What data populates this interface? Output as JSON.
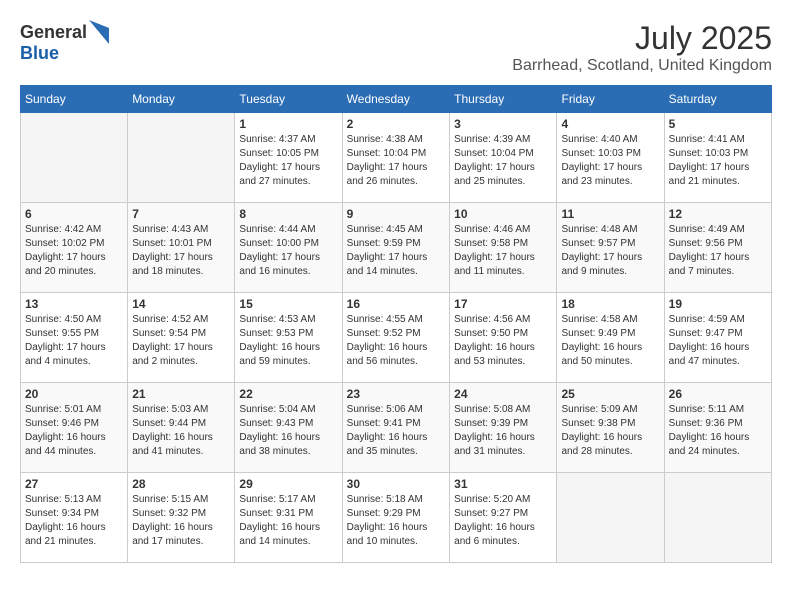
{
  "header": {
    "logo_general": "General",
    "logo_blue": "Blue",
    "month_title": "July 2025",
    "location": "Barrhead, Scotland, United Kingdom"
  },
  "weekdays": [
    "Sunday",
    "Monday",
    "Tuesday",
    "Wednesday",
    "Thursday",
    "Friday",
    "Saturday"
  ],
  "weeks": [
    [
      {
        "day": "",
        "info": ""
      },
      {
        "day": "",
        "info": ""
      },
      {
        "day": "1",
        "info": "Sunrise: 4:37 AM\nSunset: 10:05 PM\nDaylight: 17 hours and 27 minutes."
      },
      {
        "day": "2",
        "info": "Sunrise: 4:38 AM\nSunset: 10:04 PM\nDaylight: 17 hours and 26 minutes."
      },
      {
        "day": "3",
        "info": "Sunrise: 4:39 AM\nSunset: 10:04 PM\nDaylight: 17 hours and 25 minutes."
      },
      {
        "day": "4",
        "info": "Sunrise: 4:40 AM\nSunset: 10:03 PM\nDaylight: 17 hours and 23 minutes."
      },
      {
        "day": "5",
        "info": "Sunrise: 4:41 AM\nSunset: 10:03 PM\nDaylight: 17 hours and 21 minutes."
      }
    ],
    [
      {
        "day": "6",
        "info": "Sunrise: 4:42 AM\nSunset: 10:02 PM\nDaylight: 17 hours and 20 minutes."
      },
      {
        "day": "7",
        "info": "Sunrise: 4:43 AM\nSunset: 10:01 PM\nDaylight: 17 hours and 18 minutes."
      },
      {
        "day": "8",
        "info": "Sunrise: 4:44 AM\nSunset: 10:00 PM\nDaylight: 17 hours and 16 minutes."
      },
      {
        "day": "9",
        "info": "Sunrise: 4:45 AM\nSunset: 9:59 PM\nDaylight: 17 hours and 14 minutes."
      },
      {
        "day": "10",
        "info": "Sunrise: 4:46 AM\nSunset: 9:58 PM\nDaylight: 17 hours and 11 minutes."
      },
      {
        "day": "11",
        "info": "Sunrise: 4:48 AM\nSunset: 9:57 PM\nDaylight: 17 hours and 9 minutes."
      },
      {
        "day": "12",
        "info": "Sunrise: 4:49 AM\nSunset: 9:56 PM\nDaylight: 17 hours and 7 minutes."
      }
    ],
    [
      {
        "day": "13",
        "info": "Sunrise: 4:50 AM\nSunset: 9:55 PM\nDaylight: 17 hours and 4 minutes."
      },
      {
        "day": "14",
        "info": "Sunrise: 4:52 AM\nSunset: 9:54 PM\nDaylight: 17 hours and 2 minutes."
      },
      {
        "day": "15",
        "info": "Sunrise: 4:53 AM\nSunset: 9:53 PM\nDaylight: 16 hours and 59 minutes."
      },
      {
        "day": "16",
        "info": "Sunrise: 4:55 AM\nSunset: 9:52 PM\nDaylight: 16 hours and 56 minutes."
      },
      {
        "day": "17",
        "info": "Sunrise: 4:56 AM\nSunset: 9:50 PM\nDaylight: 16 hours and 53 minutes."
      },
      {
        "day": "18",
        "info": "Sunrise: 4:58 AM\nSunset: 9:49 PM\nDaylight: 16 hours and 50 minutes."
      },
      {
        "day": "19",
        "info": "Sunrise: 4:59 AM\nSunset: 9:47 PM\nDaylight: 16 hours and 47 minutes."
      }
    ],
    [
      {
        "day": "20",
        "info": "Sunrise: 5:01 AM\nSunset: 9:46 PM\nDaylight: 16 hours and 44 minutes."
      },
      {
        "day": "21",
        "info": "Sunrise: 5:03 AM\nSunset: 9:44 PM\nDaylight: 16 hours and 41 minutes."
      },
      {
        "day": "22",
        "info": "Sunrise: 5:04 AM\nSunset: 9:43 PM\nDaylight: 16 hours and 38 minutes."
      },
      {
        "day": "23",
        "info": "Sunrise: 5:06 AM\nSunset: 9:41 PM\nDaylight: 16 hours and 35 minutes."
      },
      {
        "day": "24",
        "info": "Sunrise: 5:08 AM\nSunset: 9:39 PM\nDaylight: 16 hours and 31 minutes."
      },
      {
        "day": "25",
        "info": "Sunrise: 5:09 AM\nSunset: 9:38 PM\nDaylight: 16 hours and 28 minutes."
      },
      {
        "day": "26",
        "info": "Sunrise: 5:11 AM\nSunset: 9:36 PM\nDaylight: 16 hours and 24 minutes."
      }
    ],
    [
      {
        "day": "27",
        "info": "Sunrise: 5:13 AM\nSunset: 9:34 PM\nDaylight: 16 hours and 21 minutes."
      },
      {
        "day": "28",
        "info": "Sunrise: 5:15 AM\nSunset: 9:32 PM\nDaylight: 16 hours and 17 minutes."
      },
      {
        "day": "29",
        "info": "Sunrise: 5:17 AM\nSunset: 9:31 PM\nDaylight: 16 hours and 14 minutes."
      },
      {
        "day": "30",
        "info": "Sunrise: 5:18 AM\nSunset: 9:29 PM\nDaylight: 16 hours and 10 minutes."
      },
      {
        "day": "31",
        "info": "Sunrise: 5:20 AM\nSunset: 9:27 PM\nDaylight: 16 hours and 6 minutes."
      },
      {
        "day": "",
        "info": ""
      },
      {
        "day": "",
        "info": ""
      }
    ]
  ]
}
